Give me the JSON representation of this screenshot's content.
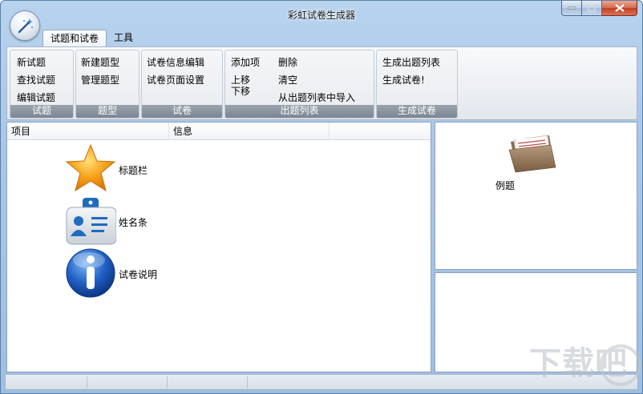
{
  "window": {
    "title": "彩虹试卷生成器"
  },
  "tabs": [
    {
      "label": "试题和试卷",
      "active": true
    },
    {
      "label": "工具",
      "active": false
    }
  ],
  "ribbon": {
    "groups": [
      {
        "label": "试题",
        "buttons": [
          "新试题",
          "查找试题",
          "编辑试题"
        ]
      },
      {
        "label": "题型",
        "buttons": [
          "新建题型",
          "管理题型"
        ]
      },
      {
        "label": "试卷",
        "buttons": [
          "试卷信息编辑",
          "试卷页面设置"
        ]
      },
      {
        "label": "出题列表",
        "buttons": [
          "添加项",
          "删除",
          "上移",
          "清空",
          "下移",
          "从出题列表中导入"
        ]
      },
      {
        "label": "生成试卷",
        "buttons": [
          "生成出题列表",
          "生成试卷!"
        ]
      }
    ]
  },
  "list": {
    "columns": [
      "项目",
      "信息",
      ""
    ],
    "items": [
      {
        "label": "标题栏",
        "icon": "star-icon"
      },
      {
        "label": "姓名条",
        "icon": "name-badge-icon"
      },
      {
        "label": "试卷说明",
        "icon": "info-icon"
      }
    ]
  },
  "preview": {
    "example_label": "例题",
    "icon": "folder-files-icon"
  },
  "watermark": {
    "text": "下载吧"
  },
  "colors": {
    "frame": "#a9c6e6",
    "close": "#c2401f",
    "star": "#f7a21b",
    "info": "#1f5fc4"
  }
}
